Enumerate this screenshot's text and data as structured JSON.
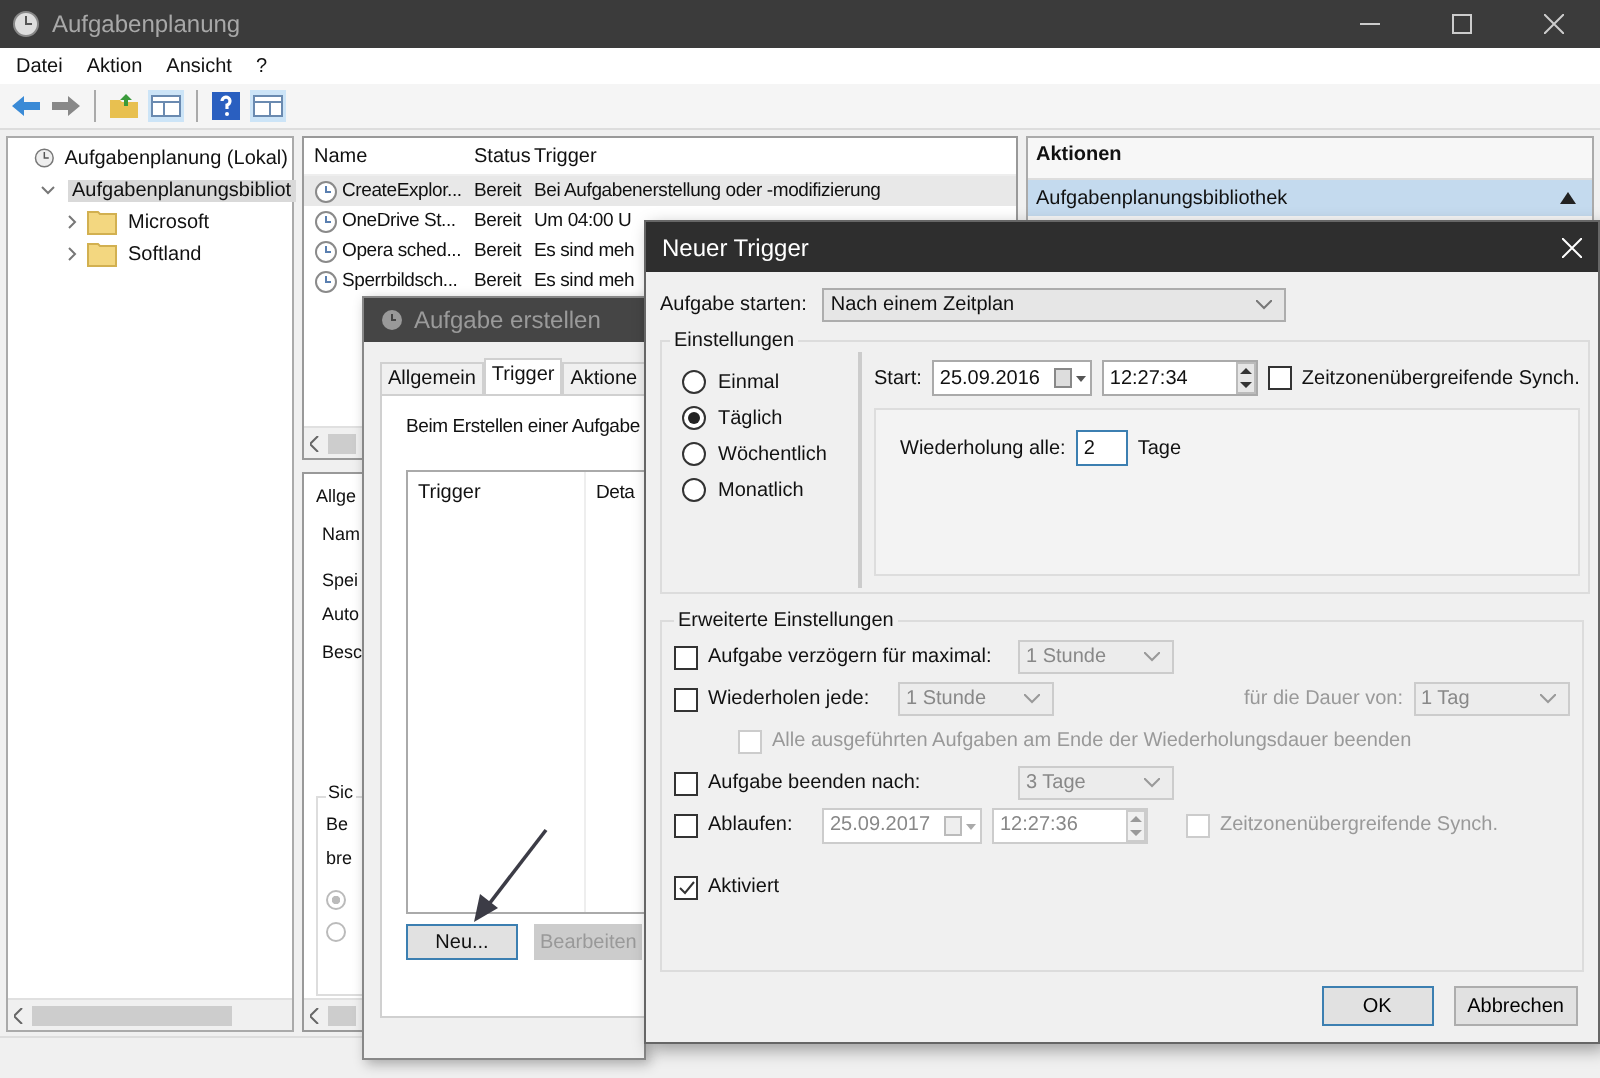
{
  "main_window": {
    "title": "Aufgabenplanung",
    "menu": [
      "Datei",
      "Aktion",
      "Ansicht",
      "?"
    ],
    "tree": [
      {
        "label": "Aufgabenplanung (Lokal)",
        "kind": "root",
        "selected": false,
        "children": [
          {
            "label": "Aufgabenplanungsbibliot",
            "kind": "library",
            "selected": true,
            "expanded": true,
            "children": [
              {
                "label": "Microsoft",
                "kind": "folder",
                "selected": false,
                "expanded": false
              },
              {
                "label": "Softland",
                "kind": "folder",
                "selected": false,
                "expanded": false
              }
            ]
          }
        ]
      }
    ],
    "task_table": {
      "columns": [
        "Name",
        "Status",
        "Trigger"
      ],
      "rows": [
        {
          "name": "CreateExplor...",
          "status": "Bereit",
          "trigger": "Bei Aufgabenerstellung oder -modifizierung",
          "selected": true
        },
        {
          "name": "OneDrive St...",
          "status": "Bereit",
          "trigger": "Um 04:00 U",
          "selected": false
        },
        {
          "name": "Opera sched...",
          "status": "Bereit",
          "trigger": "Es sind meh",
          "selected": false
        },
        {
          "name": "Sperrbildsch...",
          "status": "Bereit",
          "trigger": "Es sind meh",
          "selected": false
        }
      ]
    },
    "detail_panel": {
      "tab": "Allge",
      "fields": [
        "Nam",
        "Spei",
        "Auto",
        "Besc"
      ],
      "group": {
        "title": "Sic",
        "lines": [
          "Be",
          "bre"
        ],
        "options": [
          {
            "selected": true
          },
          {
            "selected": false
          }
        ]
      }
    },
    "actions_panel": {
      "title": "Aktionen",
      "sections": [
        {
          "label": "Aufgabenplanungsbibliothek",
          "expanded": true
        }
      ]
    }
  },
  "create_dialog": {
    "title": "Aufgabe erstellen",
    "tabs": [
      {
        "label": "Allgemein",
        "selected": false
      },
      {
        "label": "Trigger",
        "selected": true
      },
      {
        "label": "Aktione",
        "selected": false
      }
    ],
    "hint": "Beim Erstellen einer Aufgabe",
    "list_columns": [
      "Trigger",
      "Deta"
    ],
    "buttons": [
      {
        "label": "Neu...",
        "disabled": false
      },
      {
        "label": "Bearbeiten",
        "disabled": true
      }
    ]
  },
  "trigger_dialog": {
    "title": "Neuer Trigger",
    "start_label": "Aufgabe starten:",
    "start_value": "Nach einem Zeitplan",
    "settings": {
      "title": "Einstellungen",
      "schedules": [
        {
          "label": "Einmal",
          "selected": false
        },
        {
          "label": "Täglich",
          "selected": true
        },
        {
          "label": "Wöchentlich",
          "selected": false
        },
        {
          "label": "Monatlich",
          "selected": false
        }
      ],
      "start": {
        "label": "Start:",
        "date": "25.09.2016",
        "time": "12:27:34"
      },
      "sync": {
        "label": "Zeitzonenübergreifende Synch.",
        "checked": false
      },
      "recur": {
        "label": "Wiederholung alle:",
        "value": "2",
        "unit": "Tage"
      }
    },
    "advanced": {
      "title": "Erweiterte Einstellungen",
      "delay": {
        "label": "Aufgabe verzögern für maximal:",
        "checked": false,
        "value": "1 Stunde"
      },
      "repeat": {
        "label": "Wiederholen jede:",
        "checked": false,
        "value": "1 Stunde",
        "duration_label": "für die Dauer von:",
        "duration_value": "1 Tag",
        "stop_all": {
          "label": "Alle ausgeführten Aufgaben am Ende der Wiederholungsdauer beenden",
          "checked": false
        }
      },
      "stop_after": {
        "label": "Aufgabe beenden nach:",
        "checked": false,
        "value": "3 Tage"
      },
      "expire": {
        "label": "Ablaufen:",
        "checked": false,
        "date": "25.09.2017",
        "time": "12:27:36",
        "sync": {
          "label": "Zeitzonenübergreifende Synch.",
          "checked": false
        }
      },
      "enabled": {
        "label": "Aktiviert",
        "checked": true
      }
    },
    "buttons": [
      {
        "label": "OK",
        "default": true
      },
      {
        "label": "Abbrechen",
        "default": false
      }
    ]
  }
}
